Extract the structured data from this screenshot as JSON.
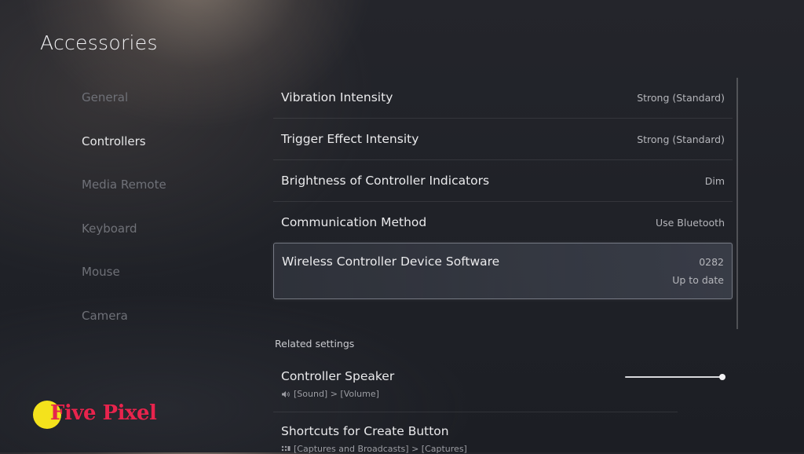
{
  "page": {
    "title": "Accessories"
  },
  "sidebar": {
    "items": [
      {
        "label": "General",
        "active": false
      },
      {
        "label": "Controllers",
        "active": true
      },
      {
        "label": "Media Remote",
        "active": false
      },
      {
        "label": "Keyboard",
        "active": false
      },
      {
        "label": "Mouse",
        "active": false
      },
      {
        "label": "Camera",
        "active": false
      }
    ]
  },
  "settings": {
    "rows": [
      {
        "label": "Vibration Intensity",
        "value": "Strong (Standard)"
      },
      {
        "label": "Trigger Effect Intensity",
        "value": "Strong (Standard)"
      },
      {
        "label": "Brightness of Controller Indicators",
        "value": "Dim"
      },
      {
        "label": "Communication Method",
        "value": "Use Bluetooth"
      },
      {
        "label": "Wireless Controller Device Software",
        "value": "0282",
        "sub_value": "Up to date",
        "selected": true
      }
    ]
  },
  "related": {
    "header": "Related settings",
    "items": [
      {
        "label": "Controller Speaker",
        "path": "[Sound] > [Volume]",
        "icon": "speaker-icon",
        "volume_level": 1.0
      },
      {
        "label": "Shortcuts for Create Button",
        "path": "[Captures and Broadcasts] > [Captures]",
        "icon": "captures-icon"
      }
    ]
  },
  "watermark": {
    "text": "Five Pixel",
    "colors": {
      "circle": "#f4e21c",
      "text": "#e8244d"
    }
  },
  "colors": {
    "background": "#202228",
    "text": "#eaeaec",
    "inactive": "#6f7178"
  }
}
